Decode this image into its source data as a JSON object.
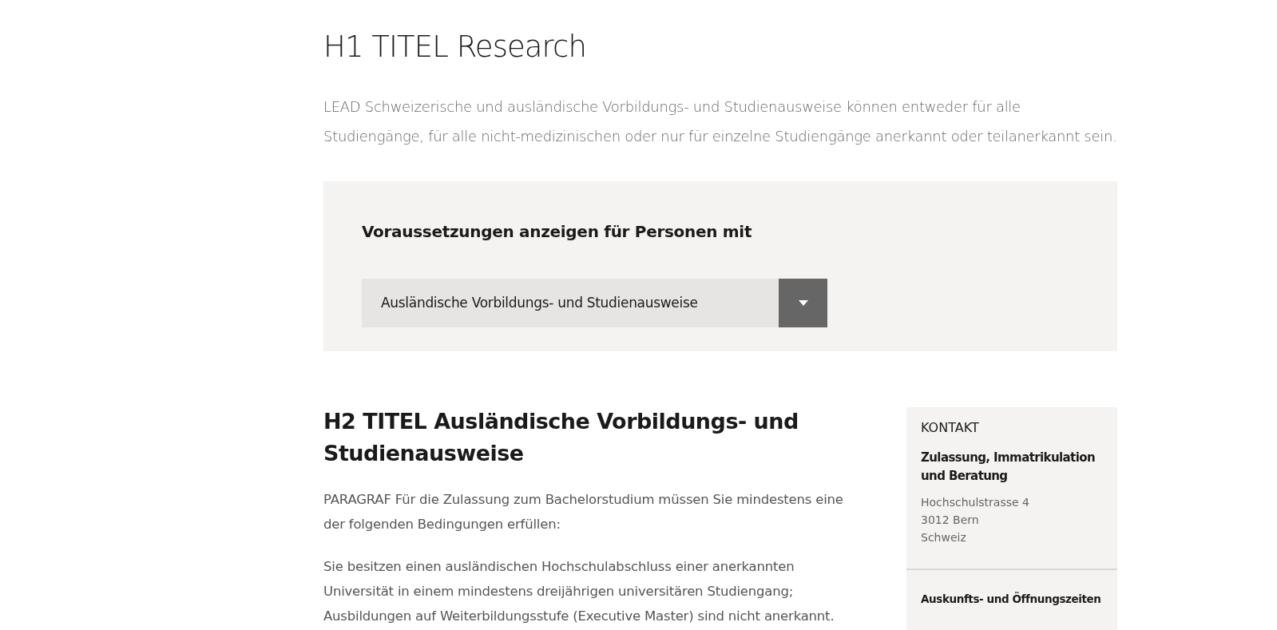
{
  "title": "H1 TITEL Research",
  "lead": "LEAD Schweizerische und ausländische Vorbildungs- und Studienausweise können entweder für alle Studiengänge, für alle nicht-medizinischen oder nur für einzelne Studiengänge anerkannt oder teilanerkannt sein.",
  "filter": {
    "label": "Voraussetzungen anzeigen für Personen mit",
    "select": {
      "value": "Ausländische Vorbildungs- und Studienausweise"
    }
  },
  "section": {
    "heading": "H2 TITEL Ausländische Vorbildungs- und Studienausweise",
    "paragraphs": [
      "PARAGRAF Für die Zulassung zum Bachelorstudium müssen Sie mindestens eine der folgenden Bedingungen erfüllen:",
      "Sie besitzen einen ausländischen Hochschulabschluss einer anerkannten Universität in einem mindestens dreijährigen universitären Studiengang; Ausbildungen auf Weiterbildungsstufe (Executive Master) sind nicht anerkannt."
    ]
  },
  "contact": {
    "label": "KONTAKT",
    "name": "Zulassung, Immatrikulation und Beratung",
    "address": [
      "Hochschulstrasse 4",
      "3012 Bern",
      "Schweiz"
    ],
    "hours_title": "Auskunfts- und Öffnungszeiten"
  }
}
